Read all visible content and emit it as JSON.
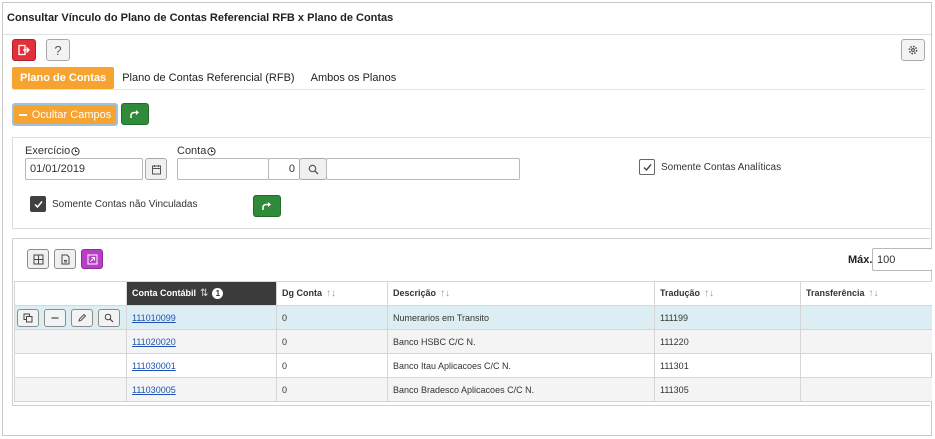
{
  "window": {
    "title": "Consultar Vínculo do Plano de Contas Referencial RFB x Plano de Contas"
  },
  "toolbar": {
    "help_label": "?"
  },
  "tabs": [
    {
      "label": "Plano de Contas",
      "active": true
    },
    {
      "label": "Plano de Contas Referencial (RFB)",
      "active": false
    },
    {
      "label": "Ambos os Planos",
      "active": false
    }
  ],
  "actions": {
    "hide_fields_label": "Ocultar Campos"
  },
  "filters": {
    "exercicio_label": "Exercício",
    "exercicio_value": "01/01/2019",
    "conta_label": "Conta",
    "conta_value": "",
    "dg_value": "0",
    "descricao_value": "",
    "somente_analiticas_label": "Somente Contas Analíticas",
    "somente_analiticas_checked": false,
    "somente_nao_vinculadas_label": "Somente Contas não Vinculadas",
    "somente_nao_vinculadas_checked": true
  },
  "grid": {
    "max_label": "Máx.",
    "max_value": "100",
    "sort_badge": "1",
    "columns": [
      {
        "label": "Conta Contábil"
      },
      {
        "label": "Dg Conta"
      },
      {
        "label": "Descrição"
      },
      {
        "label": "Tradução"
      },
      {
        "label": "Transferência"
      }
    ],
    "rows": [
      {
        "conta": "111010099",
        "dg": "0",
        "descricao": "Numerarios em Transito",
        "traducao": "111199",
        "transferencia": ""
      },
      {
        "conta": "111020020",
        "dg": "0",
        "descricao": "Banco HSBC C/C N.",
        "traducao": "111220",
        "transferencia": ""
      },
      {
        "conta": "111030001",
        "dg": "0",
        "descricao": "Banco Itau Aplicacoes C/C N.",
        "traducao": "111301",
        "transferencia": ""
      },
      {
        "conta": "111030005",
        "dg": "0",
        "descricao": "Banco Bradesco Aplicacoes C/C N.",
        "traducao": "111305",
        "transferencia": ""
      }
    ]
  },
  "colors": {
    "accent_orange": "#f6a330",
    "danger_red": "#e2303b",
    "success_green": "#2f8a3a",
    "export_purple": "#b73ec5",
    "sorted_header": "#3b3b3b",
    "selected_row": "#dcedf3",
    "link_blue": "#1e52b0"
  },
  "icons": {
    "exit": "exit-icon",
    "help": "help-icon",
    "settings": "gear-icon",
    "forward": "share-forward-icon",
    "calendar": "calendar-icon",
    "search": "search-icon",
    "check": "check-icon",
    "grid": "grid-icon",
    "document": "document-icon",
    "export": "export-icon",
    "copy": "copy-icon",
    "minus": "minus-icon",
    "edit": "pencil-icon",
    "history": "clock-icon"
  }
}
